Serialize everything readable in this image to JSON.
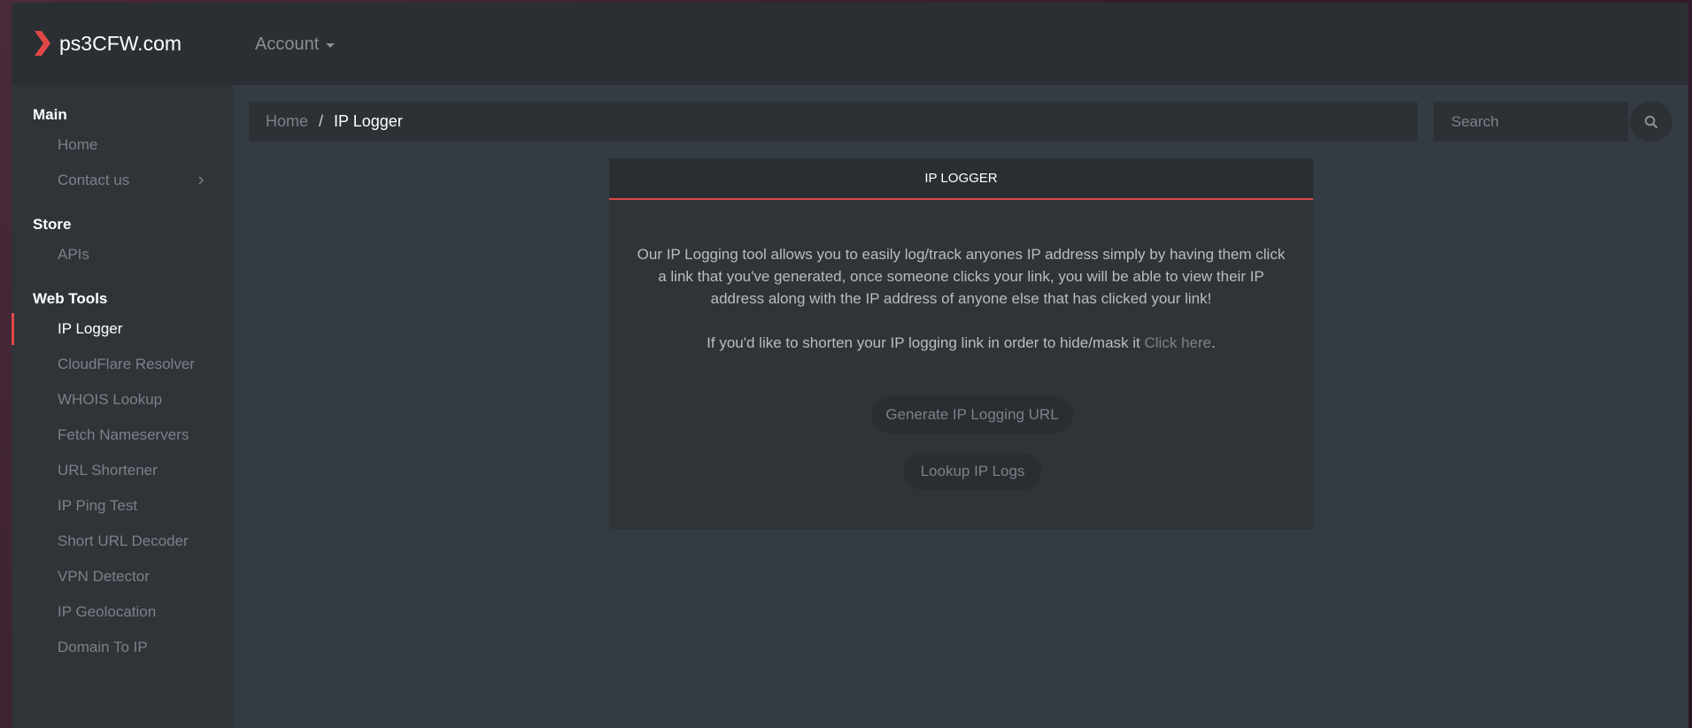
{
  "brand": {
    "name": "ps3CFW.com",
    "icon": "chevron-right-logo-icon",
    "accent_color": "#e04848"
  },
  "nav": {
    "account_label": "Account"
  },
  "sidebar": {
    "sections": [
      {
        "title": "Main",
        "items": [
          {
            "label": "Home"
          },
          {
            "label": "Contact us",
            "has_submenu": true
          }
        ]
      },
      {
        "title": "Store",
        "items": [
          {
            "label": "APIs"
          }
        ]
      },
      {
        "title": "Web Tools",
        "items": [
          {
            "label": "IP Logger",
            "active": true
          },
          {
            "label": "CloudFlare Resolver"
          },
          {
            "label": "WHOIS Lookup"
          },
          {
            "label": "Fetch Nameservers"
          },
          {
            "label": "URL Shortener"
          },
          {
            "label": "IP Ping Test"
          },
          {
            "label": "Short URL Decoder"
          },
          {
            "label": "VPN Detector"
          },
          {
            "label": "IP Geolocation"
          },
          {
            "label": "Domain To IP"
          }
        ]
      }
    ]
  },
  "breadcrumb": {
    "home": "Home",
    "separator": "/",
    "current": "IP Logger"
  },
  "search": {
    "placeholder": "Search",
    "icon": "search-icon"
  },
  "card": {
    "title": "IP LOGGER",
    "description": "Our IP Logging tool allows you to easily log/track anyones IP address simply by having them click a link that you've generated, once someone clicks your link, you will be able to view their IP address along with the IP address of anyone else that has clicked your link!",
    "shorten_prefix": "If you'd like to shorten your IP logging link in order to hide/mask it ",
    "shorten_link": "Click here",
    "shorten_suffix": ".",
    "generate_button": "Generate IP Logging URL",
    "lookup_button": "Lookup IP Logs"
  }
}
